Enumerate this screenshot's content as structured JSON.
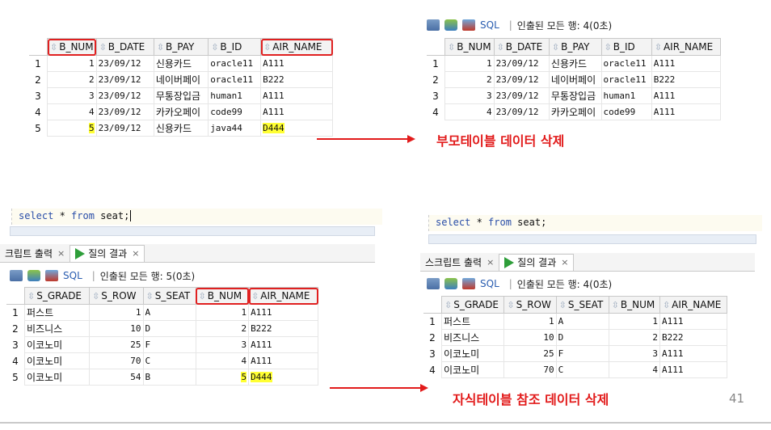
{
  "top_left": {
    "columns": [
      "B_NUM",
      "B_DATE",
      "B_PAY",
      "B_ID",
      "AIR_NAME"
    ],
    "rows": [
      {
        "rownum": "1",
        "b_num": "1",
        "b_date": "23/09/12",
        "b_pay": "신용카드",
        "b_id": "oracle11",
        "air_name": "A111"
      },
      {
        "rownum": "2",
        "b_num": "2",
        "b_date": "23/09/12",
        "b_pay": "네이버페이",
        "b_id": "oracle11",
        "air_name": "B222"
      },
      {
        "rownum": "3",
        "b_num": "3",
        "b_date": "23/09/12",
        "b_pay": "무통장입금",
        "b_id": "human1",
        "air_name": "A111"
      },
      {
        "rownum": "4",
        "b_num": "4",
        "b_date": "23/09/12",
        "b_pay": "카카오페이",
        "b_id": "code99",
        "air_name": "A111"
      },
      {
        "rownum": "5",
        "b_num": "5",
        "b_date": "23/09/12",
        "b_pay": "신용카드",
        "b_id": "java44",
        "air_name": "D444"
      }
    ]
  },
  "top_right": {
    "toolbar": {
      "sql": "SQL",
      "sep": "|",
      "status": "인출된 모든 행: 4(0초)"
    },
    "columns": [
      "B_NUM",
      "B_DATE",
      "B_PAY",
      "B_ID",
      "AIR_NAME"
    ],
    "rows": [
      {
        "rownum": "1",
        "b_num": "1",
        "b_date": "23/09/12",
        "b_pay": "신용카드",
        "b_id": "oracle11",
        "air_name": "A111"
      },
      {
        "rownum": "2",
        "b_num": "2",
        "b_date": "23/09/12",
        "b_pay": "네이버페이",
        "b_id": "oracle11",
        "air_name": "B222"
      },
      {
        "rownum": "3",
        "b_num": "3",
        "b_date": "23/09/12",
        "b_pay": "무통장입금",
        "b_id": "human1",
        "air_name": "A111"
      },
      {
        "rownum": "4",
        "b_num": "4",
        "b_date": "23/09/12",
        "b_pay": "카카오페이",
        "b_id": "code99",
        "air_name": "A111"
      }
    ]
  },
  "caption_top": "부모테이블 데이터 삭제",
  "bottom_left": {
    "editor": {
      "kw1": "select",
      "mid": " * ",
      "kw2": "from",
      "rest": " seat;"
    },
    "tabs": {
      "script": "크립트 출력",
      "result": "질의 결과",
      "close": "×"
    },
    "toolbar": {
      "sql": "SQL",
      "sep": "|",
      "status": "인출된 모든 행: 5(0초)"
    },
    "columns": [
      "S_GRADE",
      "S_ROW",
      "S_SEAT",
      "B_NUM",
      "AIR_NAME"
    ],
    "rows": [
      {
        "rownum": "1",
        "grade": "퍼스트",
        "row": "1",
        "seat": "A",
        "b_num": "1",
        "air_name": "A111"
      },
      {
        "rownum": "2",
        "grade": "비즈니스",
        "row": "10",
        "seat": "D",
        "b_num": "2",
        "air_name": "B222"
      },
      {
        "rownum": "3",
        "grade": "이코노미",
        "row": "25",
        "seat": "F",
        "b_num": "3",
        "air_name": "A111"
      },
      {
        "rownum": "4",
        "grade": "이코노미",
        "row": "70",
        "seat": "C",
        "b_num": "4",
        "air_name": "A111"
      },
      {
        "rownum": "5",
        "grade": "이코노미",
        "row": "54",
        "seat": "B",
        "b_num": "5",
        "air_name": "D444"
      }
    ]
  },
  "bottom_right": {
    "editor": {
      "kw1": "select",
      "mid": " * ",
      "kw2": "from",
      "rest": " seat;"
    },
    "tabs": {
      "script": "스크립트 출력",
      "result": "질의 결과",
      "close": "×"
    },
    "toolbar": {
      "sql": "SQL",
      "sep": "|",
      "status": "인출된 모든 행: 4(0초)"
    },
    "columns": [
      "S_GRADE",
      "S_ROW",
      "S_SEAT",
      "B_NUM",
      "AIR_NAME"
    ],
    "rows": [
      {
        "rownum": "1",
        "grade": "퍼스트",
        "row": "1",
        "seat": "A",
        "b_num": "1",
        "air_name": "A111"
      },
      {
        "rownum": "2",
        "grade": "비즈니스",
        "row": "10",
        "seat": "D",
        "b_num": "2",
        "air_name": "B222"
      },
      {
        "rownum": "3",
        "grade": "이코노미",
        "row": "25",
        "seat": "F",
        "b_num": "3",
        "air_name": "A111"
      },
      {
        "rownum": "4",
        "grade": "이코노미",
        "row": "70",
        "seat": "C",
        "b_num": "4",
        "air_name": "A111"
      }
    ]
  },
  "caption_bottom": "자식테이블 참조 데이터 삭제",
  "page_number": "41",
  "colors": {
    "accent_red": "#e21b1b",
    "highlight": "#ffff33",
    "header_bg": "#f3f3f3"
  }
}
